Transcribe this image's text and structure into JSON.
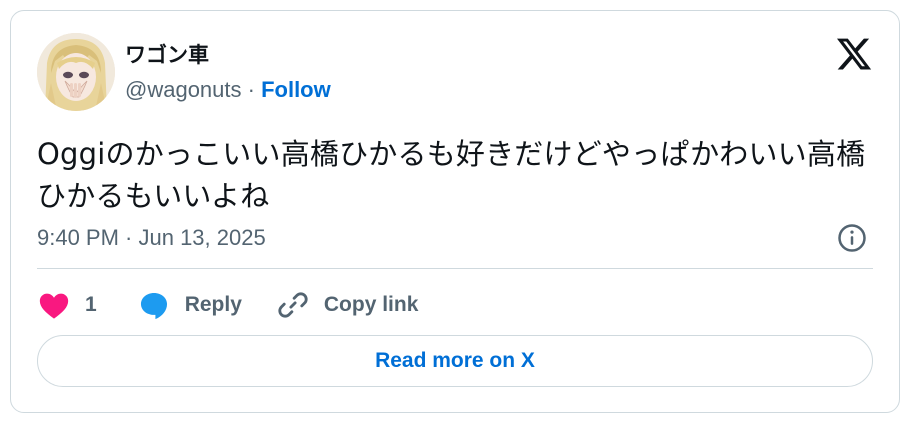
{
  "author": {
    "display_name": "ワゴン車",
    "handle": "@wagonuts",
    "separator": " · ",
    "follow_label": "Follow",
    "avatar_icon": "avatar-anime-girl"
  },
  "brand": {
    "logo_icon": "x-logo-icon"
  },
  "tweet": {
    "text": "Oggiのかっこいい高橋ひかるも好きだけどやっぱかわいい高橋ひかるもいいよね",
    "timestamp": "9:40 PM · Jun 13, 2025"
  },
  "actions": {
    "like_count": "1",
    "reply_label": "Reply",
    "copy_link_label": "Copy link"
  },
  "read_more_label": "Read more on X",
  "colors": {
    "text_primary": "#0f1419",
    "text_secondary": "#536471",
    "link_blue": "#006fd6",
    "like_pink": "#f91880",
    "reply_blue": "#1d9bf0",
    "border": "#cfd9de"
  }
}
